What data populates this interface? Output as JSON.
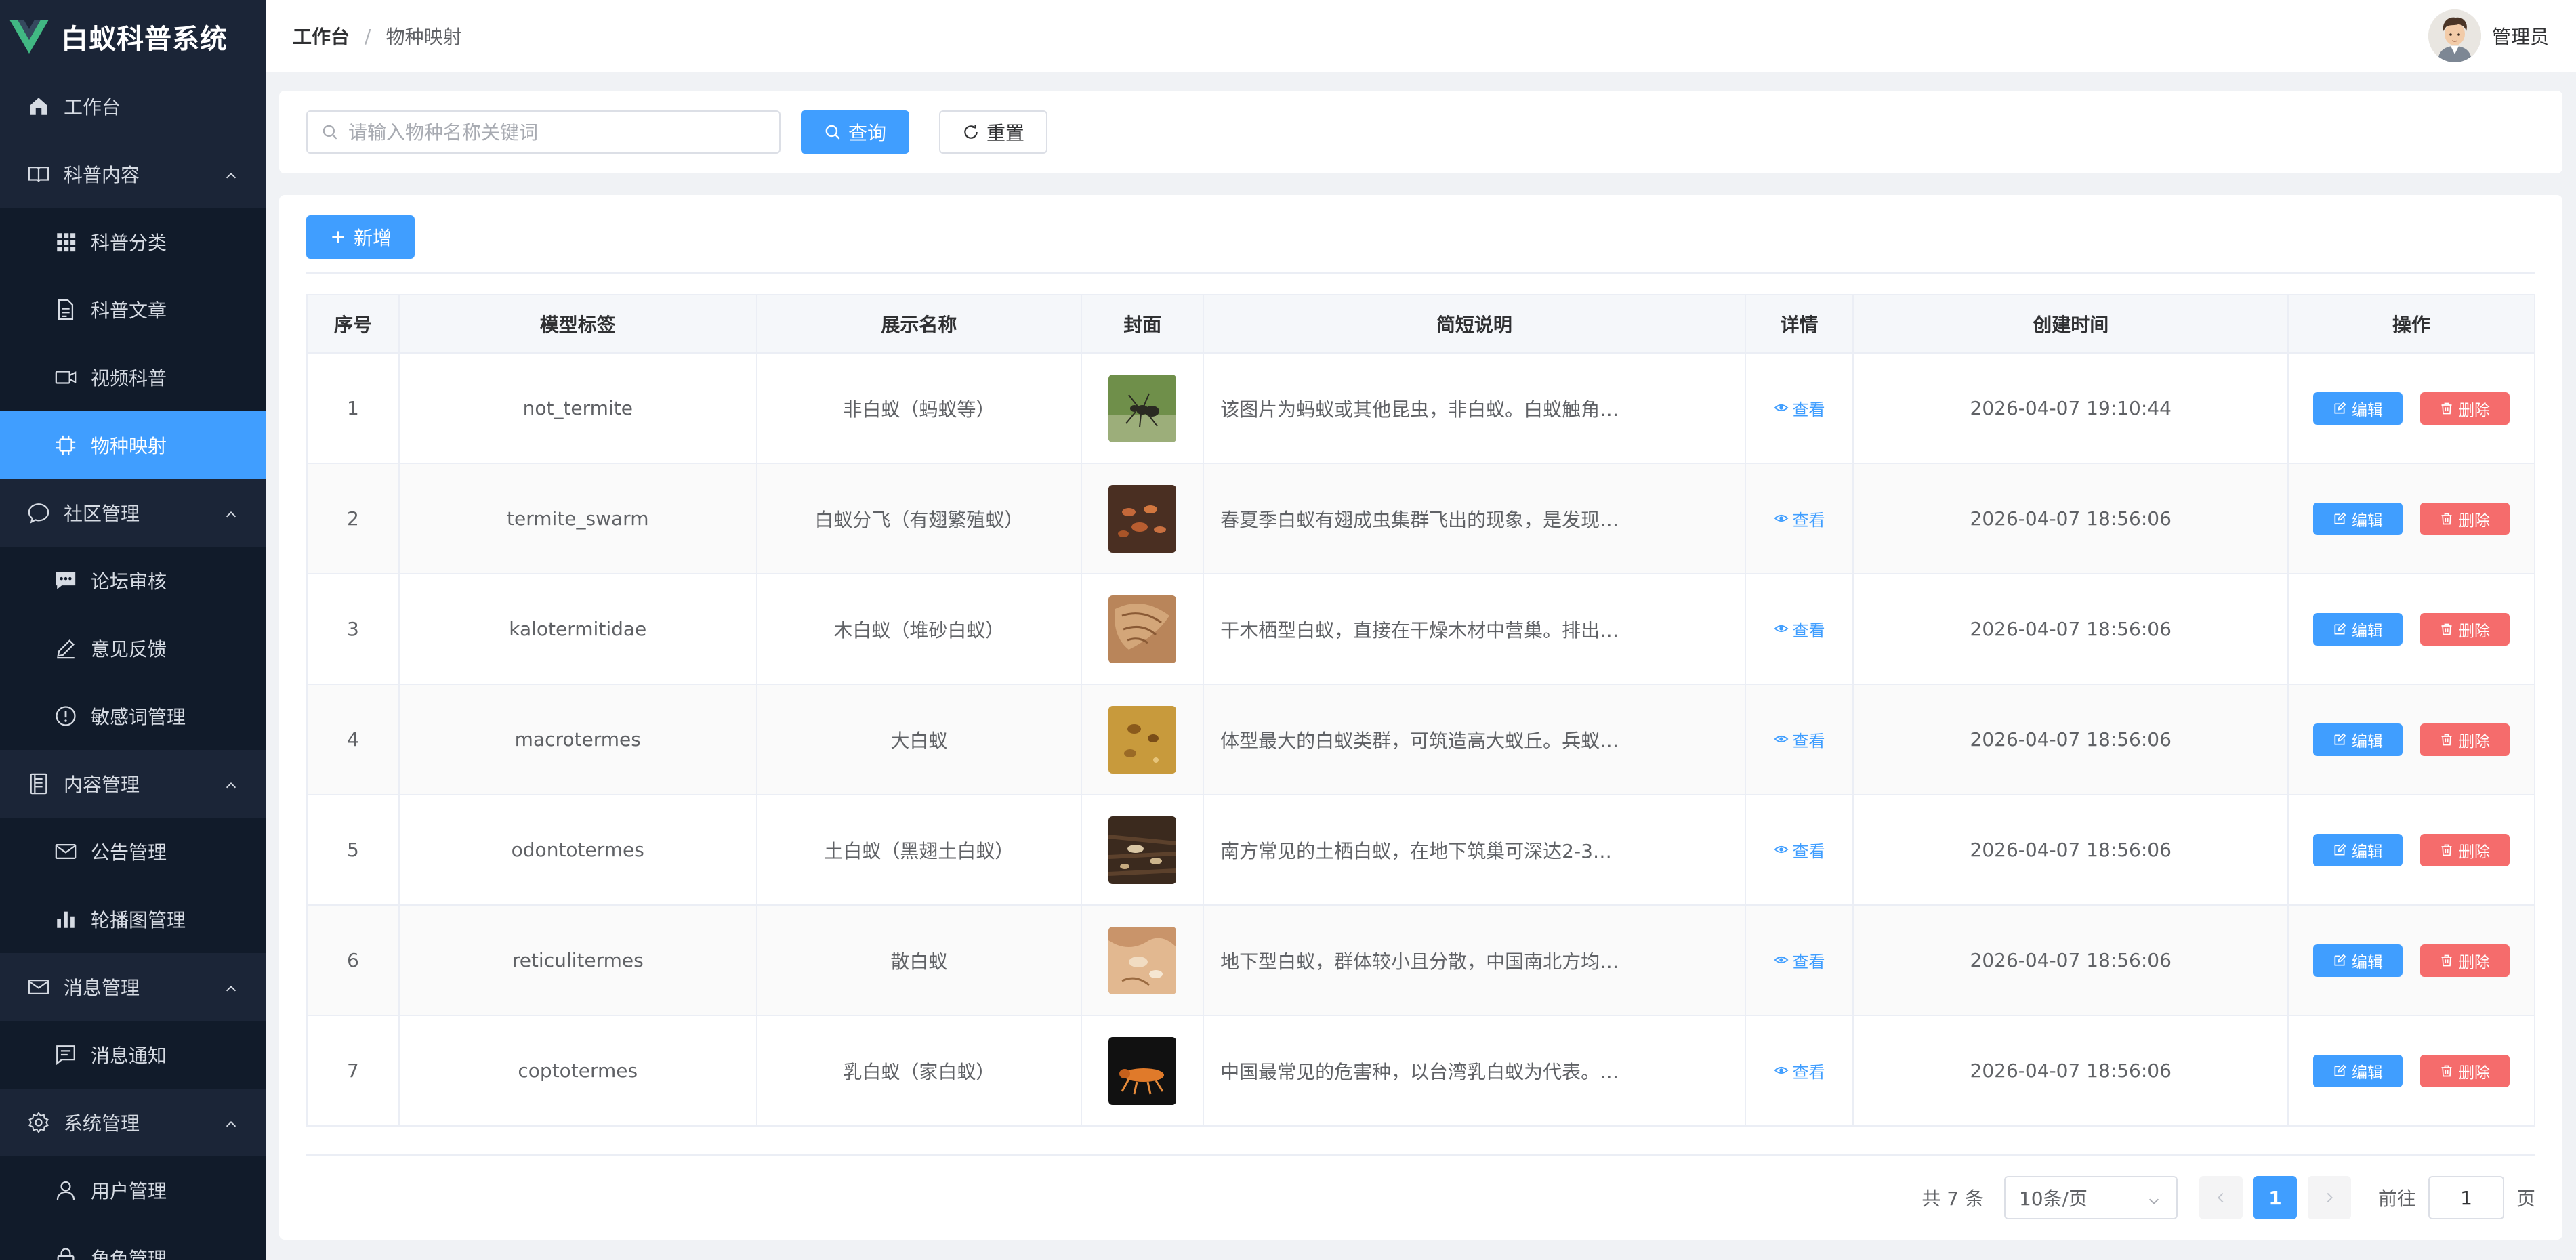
{
  "app": {
    "title": "白蚁科普系统",
    "logo_icon": "vue-logo-icon"
  },
  "sidebar": {
    "items": [
      {
        "label": "工作台",
        "icon": "home-icon",
        "level": "top"
      },
      {
        "label": "科普内容",
        "icon": "book-icon",
        "level": "top",
        "expanded": true
      },
      {
        "label": "科普分类",
        "icon": "grid-icon",
        "level": "sub"
      },
      {
        "label": "科普文章",
        "icon": "document-icon",
        "level": "sub"
      },
      {
        "label": "视频科普",
        "icon": "video-camera-icon",
        "level": "sub"
      },
      {
        "label": "物种映射",
        "icon": "chip-icon",
        "level": "sub",
        "active": true
      },
      {
        "label": "社区管理",
        "icon": "chat-bubble-icon",
        "level": "top",
        "expanded": true
      },
      {
        "label": "论坛审核",
        "icon": "chat-dots-icon",
        "level": "sub"
      },
      {
        "label": "意见反馈",
        "icon": "edit-pen-icon",
        "level": "sub"
      },
      {
        "label": "敏感词管理",
        "icon": "warning-circle-icon",
        "level": "sub"
      },
      {
        "label": "内容管理",
        "icon": "notebook-icon",
        "level": "top",
        "expanded": true
      },
      {
        "label": "公告管理",
        "icon": "message-icon",
        "level": "sub"
      },
      {
        "label": "轮播图管理",
        "icon": "bar-chart-icon",
        "level": "sub"
      },
      {
        "label": "消息管理",
        "icon": "message-icon",
        "level": "top",
        "expanded": true
      },
      {
        "label": "消息通知",
        "icon": "chat-square-icon",
        "level": "sub"
      },
      {
        "label": "系统管理",
        "icon": "gear-icon",
        "level": "top",
        "expanded": true
      },
      {
        "label": "用户管理",
        "icon": "user-icon",
        "level": "sub"
      },
      {
        "label": "角色管理",
        "icon": "lock-icon",
        "level": "sub"
      }
    ]
  },
  "header": {
    "breadcrumb_home": "工作台",
    "breadcrumb_sep": "/",
    "breadcrumb_current": "物种映射",
    "user_name": "管理员"
  },
  "search": {
    "placeholder": "请输入物种名称关键词",
    "value": "",
    "query_label": "查询",
    "reset_label": "重置"
  },
  "toolbar": {
    "add_label": "新增"
  },
  "table": {
    "columns": [
      "序号",
      "模型标签",
      "展示名称",
      "封面",
      "简短说明",
      "详情",
      "创建时间",
      "操作"
    ],
    "view_label": "查看",
    "edit_label": "编辑",
    "delete_label": "删除",
    "rows": [
      {
        "index": "1",
        "model_label": "not_termite",
        "display_name": "非白蚁（蚂蚁等）",
        "description": "该图片为蚂蚁或其他昆虫，非白蚁。白蚁触角…",
        "created_at": "2026-04-07 19:10:44",
        "cover": "ant-photo"
      },
      {
        "index": "2",
        "model_label": "termite_swarm",
        "display_name": "白蚁分飞（有翅繁殖蚁）",
        "description": "春夏季白蚁有翅成虫集群飞出的现象，是发现…",
        "created_at": "2026-04-07 18:56:06",
        "cover": "swarm-photo"
      },
      {
        "index": "3",
        "model_label": "kalotermitidae",
        "display_name": "木白蚁（堆砂白蚁）",
        "description": "干木栖型白蚁，直接在干燥木材中营巢。排出…",
        "created_at": "2026-04-07 18:56:06",
        "cover": "drywood-photo"
      },
      {
        "index": "4",
        "model_label": "macrotermes",
        "display_name": "大白蚁",
        "description": "体型最大的白蚁类群，可筑造高大蚁丘。兵蚁…",
        "created_at": "2026-04-07 18:56:06",
        "cover": "macrotermes-photo"
      },
      {
        "index": "5",
        "model_label": "odontotermes",
        "display_name": "土白蚁（黑翅土白蚁）",
        "description": "南方常见的土栖白蚁，在地下筑巢可深达2-3…",
        "created_at": "2026-04-07 18:56:06",
        "cover": "odontotermes-photo"
      },
      {
        "index": "6",
        "model_label": "reticulitermes",
        "display_name": "散白蚁",
        "description": "地下型白蚁，群体较小且分散，中国南北方均…",
        "created_at": "2026-04-07 18:56:06",
        "cover": "reticulitermes-photo"
      },
      {
        "index": "7",
        "model_label": "coptotermes",
        "display_name": "乳白蚁（家白蚁）",
        "description": "中国最常见的危害种，以台湾乳白蚁为代表。…",
        "created_at": "2026-04-07 18:56:06",
        "cover": "coptotermes-photo"
      }
    ]
  },
  "pagination": {
    "total_text": "共 7 条",
    "page_size": "10条/页",
    "current_page": "1",
    "goto_label": "前往",
    "goto_value": "1",
    "page_suffix": "页"
  },
  "colors": {
    "primary": "#409eff",
    "danger": "#f56c6c",
    "sidebar_bg": "#1b2537",
    "sidebar_sub_bg": "#111b2a"
  }
}
